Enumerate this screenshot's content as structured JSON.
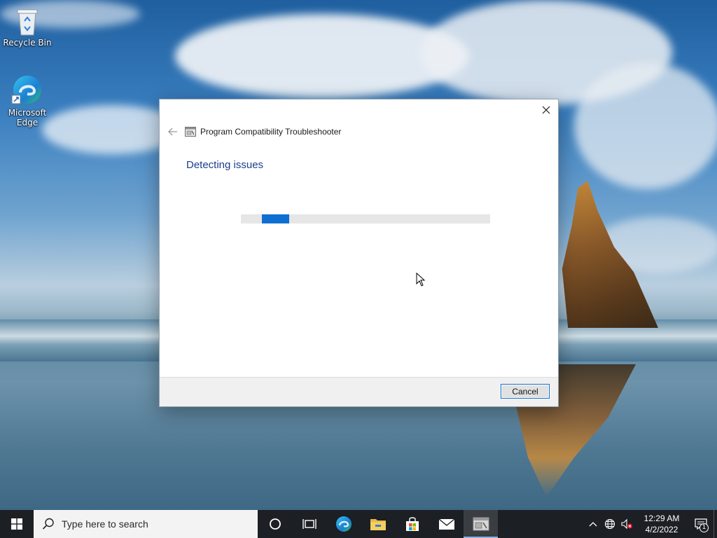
{
  "desktop": {
    "icons": [
      {
        "label": "Recycle Bin",
        "icon": "recycle-bin-icon"
      },
      {
        "label": "Microsoft Edge",
        "icon": "edge-icon"
      }
    ]
  },
  "dialog": {
    "title": "Program Compatibility Troubleshooter",
    "heading": "Detecting issues",
    "progress_state": "indeterminate",
    "cancel_label": "Cancel",
    "icons": {
      "close": "close-icon",
      "back": "back-arrow-icon",
      "app": "troubleshooter-icon"
    }
  },
  "taskbar": {
    "search_placeholder": "Type here to search",
    "pinned": [
      {
        "name": "cortana",
        "icon": "cortana-circle-icon"
      },
      {
        "name": "task-view",
        "icon": "task-view-icon"
      },
      {
        "name": "edge",
        "icon": "edge-icon"
      },
      {
        "name": "file-explorer",
        "icon": "folder-icon"
      },
      {
        "name": "microsoft-store",
        "icon": "store-icon"
      },
      {
        "name": "mail",
        "icon": "mail-icon"
      },
      {
        "name": "troubleshooter",
        "icon": "troubleshooter-icon",
        "active": true
      }
    ],
    "tray": {
      "time": "12:29 AM",
      "date": "4/2/2022",
      "notification_count": "1"
    }
  },
  "colors": {
    "accent": "#0e6fd0",
    "heading": "#1c3e8c",
    "taskbar": "#1c1f24"
  }
}
